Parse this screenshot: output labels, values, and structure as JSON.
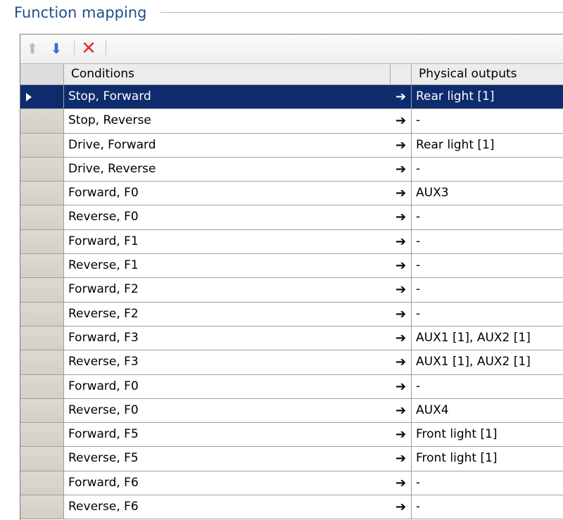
{
  "group": {
    "title": "Function mapping"
  },
  "toolbar": {
    "up_icon": "arrow-up-icon",
    "down_icon": "arrow-down-icon",
    "delete_icon": "delete-x-icon"
  },
  "columns": {
    "conditions": "Conditions",
    "outputs": "Physical outputs"
  },
  "colors": {
    "selection": "#0e2b6e",
    "title": "#1f4e8c"
  },
  "rows": [
    {
      "cond": "Stop, Forward",
      "out": "Rear light [1]",
      "selected": true
    },
    {
      "cond": "Stop, Reverse",
      "out": "-"
    },
    {
      "cond": "Drive, Forward",
      "out": "Rear light [1]"
    },
    {
      "cond": "Drive, Reverse",
      "out": "-"
    },
    {
      "cond": "Forward, F0",
      "out": "AUX3"
    },
    {
      "cond": "Reverse, F0",
      "out": "-"
    },
    {
      "cond": "Forward, F1",
      "out": "-"
    },
    {
      "cond": "Reverse, F1",
      "out": "-"
    },
    {
      "cond": "Forward, F2",
      "out": "-"
    },
    {
      "cond": "Reverse, F2",
      "out": "-"
    },
    {
      "cond": "Forward, F3",
      "out": "AUX1 [1], AUX2 [1]"
    },
    {
      "cond": "Reverse, F3",
      "out": "AUX1 [1], AUX2 [1]"
    },
    {
      "cond": "Forward, F0",
      "out": "-"
    },
    {
      "cond": "Reverse, F0",
      "out": "AUX4"
    },
    {
      "cond": "Forward, F5",
      "out": "Front light [1]"
    },
    {
      "cond": "Reverse, F5",
      "out": "Front light [1]"
    },
    {
      "cond": "Forward, F6",
      "out": "-"
    },
    {
      "cond": "Reverse, F6",
      "out": "-"
    }
  ]
}
